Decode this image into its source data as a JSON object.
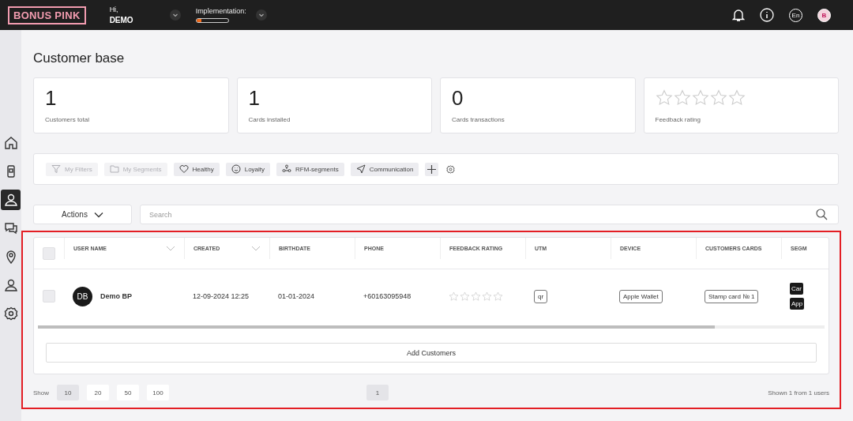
{
  "header": {
    "logo": "BONUS PINK",
    "greeting": "Hi,",
    "user": "DEMO",
    "implementation": {
      "label": "Implementation:",
      "level": 0.15
    },
    "language": "En",
    "avatar": "B"
  },
  "sidebar": {
    "items": [
      {
        "kind": "home",
        "selected": false
      },
      {
        "kind": "device",
        "selected": false
      },
      {
        "kind": "customers",
        "selected": true
      },
      {
        "kind": "chat",
        "selected": false
      },
      {
        "kind": "location",
        "selected": false
      },
      {
        "kind": "user",
        "selected": false
      },
      {
        "kind": "settings",
        "selected": false
      }
    ]
  },
  "title": "Customer base",
  "stats": [
    {
      "kind": "number",
      "value": "1",
      "label": "Customers total"
    },
    {
      "kind": "number",
      "value": "1",
      "label": "Cards installed"
    },
    {
      "kind": "number",
      "value": "0",
      "label": "Cards transactions"
    },
    {
      "kind": "stars",
      "stars": 0,
      "label": "Feedback rating"
    }
  ],
  "filters": [
    {
      "kind": "funnel",
      "label": "My Filters",
      "disabled": true
    },
    {
      "kind": "folder",
      "label": "My Segments",
      "disabled": true
    },
    {
      "kind": "heart",
      "label": "Healthy",
      "disabled": false
    },
    {
      "kind": "smile",
      "label": "Loyalty",
      "disabled": false
    },
    {
      "kind": "nodes",
      "label": "RFM-segments",
      "disabled": false
    },
    {
      "kind": "send",
      "label": "Communication",
      "disabled": false
    }
  ],
  "actions": {
    "label": "Actions"
  },
  "search": {
    "placeholder": "Search"
  },
  "table": {
    "columns": [
      {
        "label": "USER NAME",
        "sortable": true
      },
      {
        "label": "CREATED",
        "sortable": true
      },
      {
        "label": "BIRTHDATE",
        "sortable": false
      },
      {
        "label": "PHONE",
        "sortable": false
      },
      {
        "label": "FEEDBACK RATING",
        "sortable": false
      },
      {
        "label": "UTM",
        "sortable": false
      },
      {
        "label": "DEVICE",
        "sortable": false
      },
      {
        "label": "CUSTOMERS CARDS",
        "sortable": false
      },
      {
        "label": "SEGM",
        "sortable": false
      }
    ],
    "header_checked": false,
    "rows": [
      {
        "checked": false,
        "initials": "DB",
        "name": "Demo BP",
        "created": "12-09-2024 12:25",
        "birthdate": "01-01-2024",
        "phone": "+60163095948",
        "stars": 0,
        "utm": "qr",
        "device": "Apple Wallet",
        "card": "Stamp card № 1",
        "segments": [
          "Car",
          "App"
        ]
      }
    ]
  },
  "add_button": "Add Customers",
  "pagination": {
    "show_label": "Show",
    "sizes": [
      {
        "label": "10",
        "selected": true
      },
      {
        "label": "20",
        "selected": false
      },
      {
        "label": "50",
        "selected": false
      },
      {
        "label": "100",
        "selected": false
      }
    ],
    "pages": [
      {
        "label": "1",
        "selected": true
      }
    ],
    "summary": "Shown 1 from 1 users"
  }
}
